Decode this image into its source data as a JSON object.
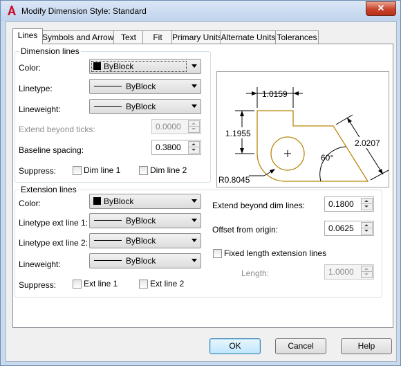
{
  "window": {
    "title": "Modify Dimension Style: Standard",
    "close_glyph": "✕"
  },
  "tabs": [
    {
      "label": "Lines"
    },
    {
      "label": "Symbols and Arrows"
    },
    {
      "label": "Text"
    },
    {
      "label": "Fit"
    },
    {
      "label": "Primary Units"
    },
    {
      "label": "Alternate Units"
    },
    {
      "label": "Tolerances"
    }
  ],
  "dimension_lines": {
    "title": "Dimension lines",
    "color_label": "Color:",
    "color_value": "ByBlock",
    "linetype_label": "Linetype:",
    "linetype_value": "ByBlock",
    "lineweight_label": "Lineweight:",
    "lineweight_value": "ByBlock",
    "extend_label": "Extend beyond ticks:",
    "extend_value": "0.0000",
    "baseline_label": "Baseline spacing:",
    "baseline_value": "0.3800",
    "suppress_label": "Suppress:",
    "dim_line_1": "Dim line 1",
    "dim_line_2": "Dim line 2"
  },
  "extension_lines": {
    "title": "Extension lines",
    "color_label": "Color:",
    "color_value": "ByBlock",
    "linetype1_label": "Linetype ext line 1:",
    "linetype1_value": "ByBlock",
    "linetype2_label": "Linetype ext line 2:",
    "linetype2_value": "ByBlock",
    "lineweight_label": "Lineweight:",
    "lineweight_value": "ByBlock",
    "suppress_label": "Suppress:",
    "ext_line_1": "Ext line 1",
    "ext_line_2": "Ext line 2",
    "extend_beyond_label": "Extend beyond dim lines:",
    "extend_beyond_value": "0.1800",
    "offset_label": "Offset from origin:",
    "offset_value": "0.0625",
    "fixed_length_label": "Fixed length extension lines",
    "length_label": "Length:",
    "length_value": "1.0000"
  },
  "preview": {
    "dim_top": "1.0159",
    "dim_left": "1.1955",
    "dim_right": "2.0207",
    "angle": "60°",
    "radius": "R0.8045",
    "shape_color": "#b8860b"
  },
  "buttons": {
    "ok": "OK",
    "cancel": "Cancel",
    "help": "Help"
  },
  "colors": {
    "accent": "#3c7fb1",
    "title_bar": "#c9daef",
    "close": "#c7432b"
  }
}
